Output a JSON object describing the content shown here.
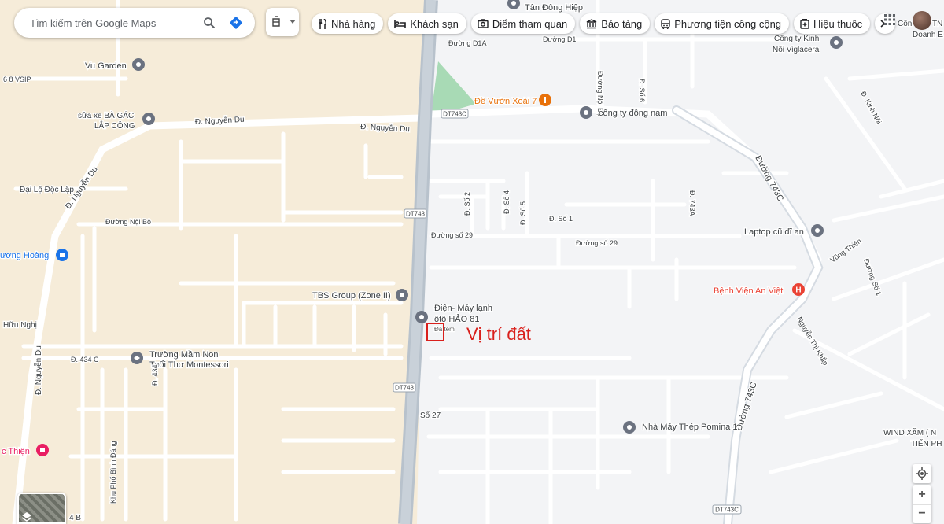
{
  "search": {
    "placeholder": "Tìm kiếm trên Google Maps"
  },
  "icons": {
    "search": "search-icon",
    "directions": "directions-icon",
    "layers": "layers-icon",
    "apps": "apps-grid-icon",
    "location": "my-location-icon"
  },
  "chips": [
    {
      "icon": "restaurant-icon",
      "label": "Nhà hàng"
    },
    {
      "icon": "hotel-icon",
      "label": "Khách sạn"
    },
    {
      "icon": "camera-icon",
      "label": "Điểm tham quan"
    },
    {
      "icon": "museum-icon",
      "label": "Bảo tàng"
    },
    {
      "icon": "transit-icon",
      "label": "Phương tiện công cộng"
    },
    {
      "icon": "pharmacy-icon",
      "label": "Hiệu thuốc"
    }
  ],
  "zoom": {
    "in": "+",
    "out": "−"
  },
  "annotation": {
    "text": "Vị trí đất",
    "color": "#d9201c"
  },
  "colors": {
    "water_map_bg": "#f3f4f6",
    "landuse": "#f6ecd9",
    "road": "#ffffff",
    "highway": "#aab6c3",
    "park": "#a8dab5",
    "poi_gray": "#6b7280",
    "poi_orange": "#e8710a",
    "poi_red": "#ea4335",
    "poi_blue": "#1a73e8",
    "poi_pink": "#e91e63"
  },
  "map_labels": [
    "Tân Đông Hiệp",
    "Đường D1A",
    "Đường D1",
    "Đường Nội Bộ",
    "Đ. Số 6",
    "Công ty Kinh",
    "Nối Viglacera",
    "Vu Garden",
    "6 8 VSIP",
    "Đề Vườn Xoài 7",
    "công ty đông nam",
    "sửa xe BÀ GÁC",
    "LẮP CÔNG",
    "Đ. Nguyễn Du",
    "Đ. Nguyễn Du",
    "DT743C",
    "Đ. Kinh Nối",
    "Đường 743C",
    "Đại Lộ Độc Lập",
    "Đ. Nguyễn Du",
    "Đường Nội Bộ",
    "DT743",
    "Đ. Số 2",
    "Đ. Số 4",
    "Đ. Số 5",
    "Đ. Số 1",
    "Đường số 29",
    "Đường số 29",
    "Đ. 743A",
    "Laptop cũ dĩ an",
    "ương Hoàng",
    "Vũng Thiện",
    "Đường Số 1",
    "TBS Group (Zone II)",
    "Bệnh Viện An Việt",
    "Điện- Máy lạnh",
    "ôtô HẢO 81",
    "Đà tem",
    "Nguyễn Thị Khắp",
    "Hữu Nghị",
    "Trường Mầm Non",
    "Tuổi Thơ Montessori",
    "Đ. 434 C",
    "Đ. Nguyễn Du",
    "Đ. 434",
    "DT743",
    "Đường 743C",
    "Số 27",
    "Nhà Máy Thép Pomina 1",
    "WIND XĂM ( N",
    "TIẾN PH",
    "c Thiện",
    "Khu Phố Bình Đáng",
    "4 B",
    "DT743C",
    "Côn",
    "Doanh E",
    "TN"
  ]
}
